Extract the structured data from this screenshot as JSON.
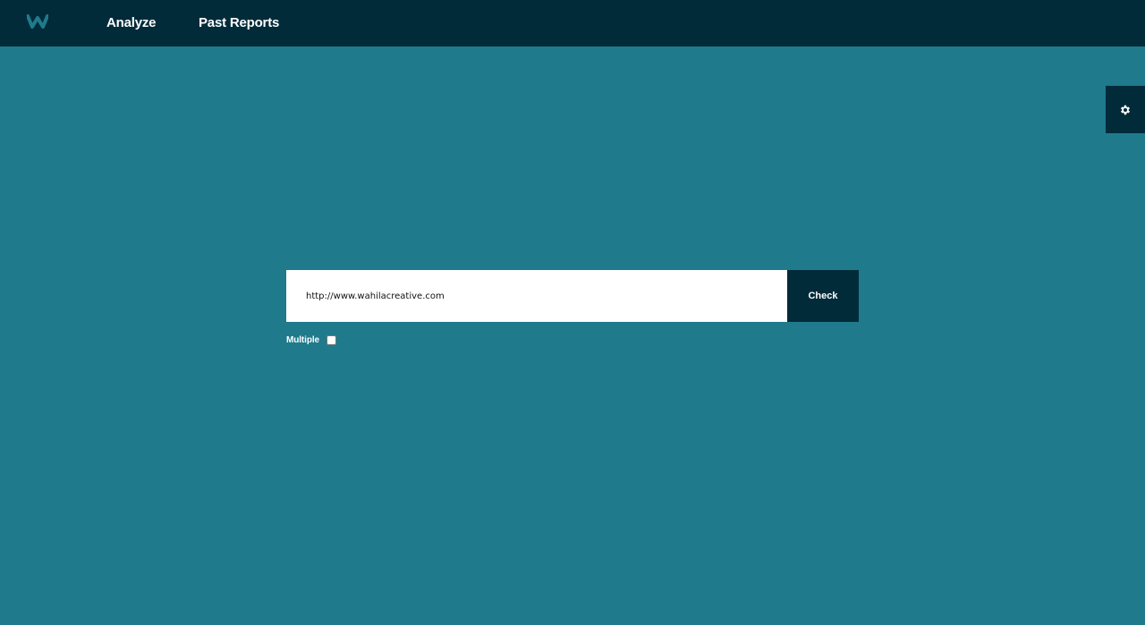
{
  "colors": {
    "background": "#1f7a8c",
    "navbar": "#022b3a",
    "logo": "#1f7a8c",
    "text": "#ffffff"
  },
  "header": {
    "logo_icon": "w-logo-icon",
    "nav": [
      {
        "label": "Analyze"
      },
      {
        "label": "Past Reports"
      }
    ]
  },
  "settings": {
    "icon": "gear-icon"
  },
  "search": {
    "url_value": "http://www.wahilacreative.com",
    "check_label": "Check"
  },
  "options": {
    "multiple_label": "Multiple",
    "multiple_checked": false
  }
}
